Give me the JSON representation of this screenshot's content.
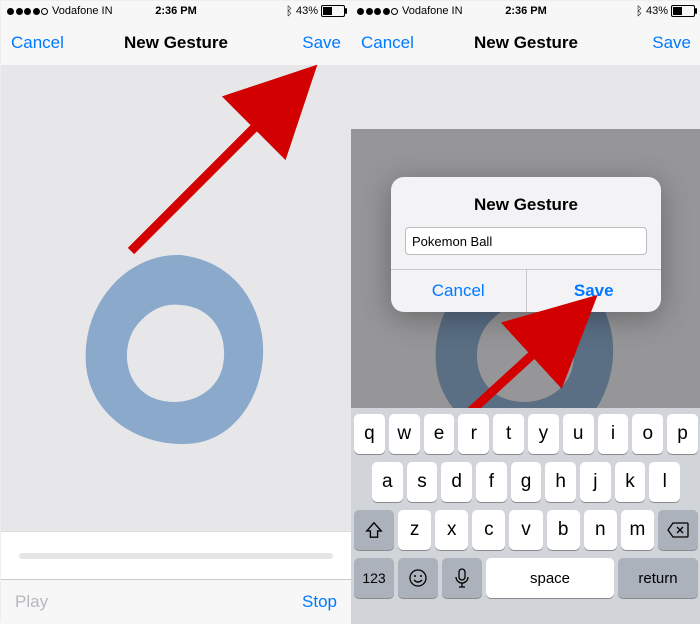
{
  "status": {
    "carrier": "Vodafone IN",
    "time": "2:36 PM",
    "battery_percent": "43%"
  },
  "nav": {
    "cancel": "Cancel",
    "title": "New Gesture",
    "save": "Save"
  },
  "toolbar": {
    "play": "Play",
    "stop": "Stop"
  },
  "alert": {
    "title": "New Gesture",
    "input_value": "Pokemon Ball",
    "cancel": "Cancel",
    "save": "Save"
  },
  "keyboard": {
    "row1": [
      "q",
      "w",
      "e",
      "r",
      "t",
      "y",
      "u",
      "i",
      "o",
      "p"
    ],
    "row2": [
      "a",
      "s",
      "d",
      "f",
      "g",
      "h",
      "j",
      "k",
      "l"
    ],
    "row3": [
      "z",
      "x",
      "c",
      "v",
      "b",
      "n",
      "m"
    ],
    "numbers": "123",
    "space": "space",
    "return": "return"
  }
}
